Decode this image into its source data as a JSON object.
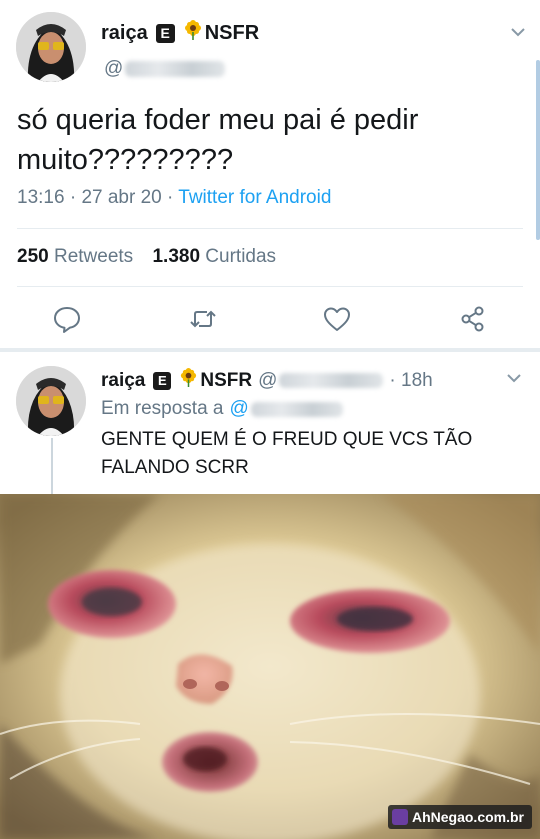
{
  "main_tweet": {
    "display_name": "raiça",
    "badge": "E",
    "suffix": "NSFR",
    "text": "só queria foder meu pai é pedir muito?????????",
    "time": "13:16",
    "date": "27 abr 20",
    "source": "Twitter for Android",
    "retweets_count": "250",
    "retweets_label": "Retweets",
    "likes_count": "1.380",
    "likes_label": "Curtidas",
    "actions": [
      "reply-icon",
      "retweet-icon",
      "like-icon",
      "share-icon"
    ]
  },
  "reply_tweet": {
    "display_name": "raiça",
    "badge": "E",
    "suffix": "NSFR",
    "handle_prefix": "@",
    "age": "· 18h",
    "reply_to_label": "Em resposta a",
    "reply_to_prefix": "@",
    "text": "GENTE QUEM É O FREUD QUE VCS TÃO FALANDO SCRR"
  },
  "watermark": {
    "text": "AhNegao.com.br"
  },
  "colors": {
    "link": "#1da1f2",
    "secondary_text": "#657786",
    "divider": "#e6ecf0"
  }
}
